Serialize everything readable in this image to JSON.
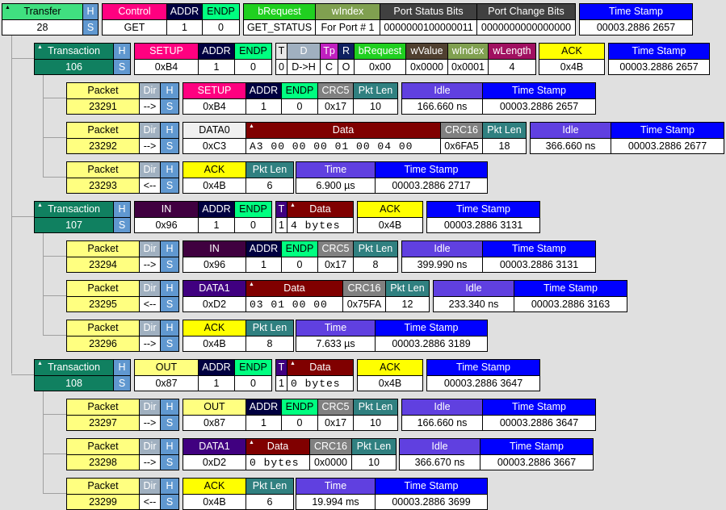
{
  "colors": {
    "transfer": "#40e080",
    "transaction": "#108060",
    "hs": "#6098d0",
    "packet": "#ffff80",
    "dir": "#a0b0c0",
    "addr": "#000040",
    "endp": "#00ff80",
    "setup": "#ff0080",
    "control": "#ff0080",
    "in": "#400040",
    "out": "#ffff80",
    "data0": "#f0f0f0",
    "data1": "#400080",
    "data": "#800000",
    "crc": "#808080",
    "pktlen": "#308080",
    "idle": "#6040e0",
    "timestamp": "#0000ff",
    "ack": "#ffff00",
    "brequest": "#20d020",
    "windex": "#80a050",
    "bits": "#404040",
    "wvalue": "#504030",
    "wlength": "#a01060",
    "tp": "#c020c0",
    "r": "#102060",
    "t": "#e8e8e8",
    "t2": "#400080",
    "d": "#a0b0c0"
  },
  "rows": [
    {
      "groups": [
        [
          {
            "h": "Transfer",
            "v": "28",
            "c": "transfer",
            "dark": 1,
            "mark": 1
          },
          {
            "h": "H",
            "v": "S",
            "c": "hs",
            "vc": "hs"
          }
        ],
        [
          {
            "h": "Control",
            "v": "GET",
            "c": "control"
          },
          {
            "h": "ADDR",
            "v": "1",
            "c": "addr"
          },
          {
            "h": "ENDP",
            "v": "0",
            "c": "endp",
            "dark": 1
          }
        ],
        [
          {
            "h": "bRequest",
            "v": "GET_STATUS",
            "c": "brequest"
          },
          {
            "h": "wIndex",
            "v": "For Port # 1",
            "c": "windex"
          },
          {
            "h": "Port Status Bits",
            "v": "0000000100000011",
            "c": "bits"
          },
          {
            "h": "Port Change Bits",
            "v": "0000000000000000",
            "c": "bits"
          }
        ],
        [
          {
            "h": "Time Stamp",
            "v": "00003.2886 2657",
            "c": "timestamp"
          }
        ]
      ]
    },
    {
      "groups": [
        [
          {
            "h": "Transaction",
            "v": "106",
            "c": "transaction",
            "vc": "transaction",
            "mark": 1
          },
          {
            "h": "H",
            "v": "S",
            "c": "hs",
            "vc": "hs"
          }
        ],
        [
          {
            "h": "SETUP",
            "v": "0xB4",
            "c": "setup"
          },
          {
            "h": "ADDR",
            "v": "1",
            "c": "addr"
          },
          {
            "h": "ENDP",
            "v": "0",
            "c": "endp",
            "dark": 1
          }
        ],
        [
          {
            "h": "T",
            "v": "0",
            "c": "t",
            "dark": 1
          },
          {
            "h": "D",
            "v": "D->H",
            "c": "d"
          },
          {
            "h": "Tp",
            "v": "C",
            "c": "tp"
          },
          {
            "h": "R",
            "v": "O",
            "c": "r"
          },
          {
            "h": "bRequest",
            "v": "0x00",
            "c": "brequest"
          },
          {
            "h": "wValue",
            "v": "0x0000",
            "c": "wvalue"
          },
          {
            "h": "wIndex",
            "v": "0x0001",
            "c": "windex"
          },
          {
            "h": "wLength",
            "v": "4",
            "c": "wlength"
          }
        ],
        [
          {
            "h": "ACK",
            "v": "0x4B",
            "c": "ack",
            "dark": 1
          }
        ],
        [
          {
            "h": "Time Stamp",
            "v": "00003.2886 2657",
            "c": "timestamp"
          }
        ]
      ]
    },
    {
      "groups": [
        [
          {
            "h": "Packet",
            "v": "23291",
            "c": "packet",
            "vc": "packet",
            "dark": 1
          },
          {
            "h": "Dir",
            "v": "-->",
            "c": "dir"
          },
          {
            "h": "H",
            "v": "S",
            "c": "hs",
            "vc": "hs"
          }
        ],
        [
          {
            "h": "SETUP",
            "v": "0xB4",
            "c": "setup"
          },
          {
            "h": "ADDR",
            "v": "1",
            "c": "addr"
          },
          {
            "h": "ENDP",
            "v": "0",
            "c": "endp",
            "dark": 1
          },
          {
            "h": "CRC5",
            "v": "0x17",
            "c": "crc"
          },
          {
            "h": "Pkt Len",
            "v": "10",
            "c": "pktlen"
          }
        ],
        [
          {
            "h": "Idle",
            "v": "166.660 ns",
            "c": "idle"
          },
          {
            "h": "Time Stamp",
            "v": "00003.2886 2657",
            "c": "timestamp"
          }
        ]
      ]
    },
    {
      "groups": [
        [
          {
            "h": "Packet",
            "v": "23292",
            "c": "packet",
            "vc": "packet",
            "dark": 1
          },
          {
            "h": "Dir",
            "v": "-->",
            "c": "dir"
          },
          {
            "h": "H",
            "v": "S",
            "c": "hs",
            "vc": "hs"
          }
        ],
        [
          {
            "h": "DATA0",
            "v": "0xC3",
            "c": "data0",
            "dark": 1
          },
          {
            "h": "Data",
            "v": "A3 00 00 00 01 00 04 00",
            "c": "data",
            "mono": 1,
            "mark": 1
          },
          {
            "h": "CRC16",
            "v": "0x6FA5",
            "c": "crc"
          },
          {
            "h": "Pkt Len",
            "v": "18",
            "c": "pktlen"
          }
        ],
        [
          {
            "h": "Idle",
            "v": "366.660 ns",
            "c": "idle"
          },
          {
            "h": "Time Stamp",
            "v": "00003.2886 2677",
            "c": "timestamp"
          }
        ]
      ]
    },
    {
      "groups": [
        [
          {
            "h": "Packet",
            "v": "23293",
            "c": "packet",
            "vc": "packet",
            "dark": 1
          },
          {
            "h": "Dir",
            "v": "<--",
            "c": "dir"
          },
          {
            "h": "H",
            "v": "S",
            "c": "hs",
            "vc": "hs"
          }
        ],
        [
          {
            "h": "ACK",
            "v": "0x4B",
            "c": "ack",
            "dark": 1
          },
          {
            "h": "Pkt Len",
            "v": "6",
            "c": "pktlen"
          }
        ],
        [
          {
            "h": "Time",
            "v": "6.900 µs",
            "c": "idle"
          },
          {
            "h": "Time Stamp",
            "v": "00003.2886 2717",
            "c": "timestamp"
          }
        ]
      ]
    },
    {
      "groups": [
        [
          {
            "h": "Transaction",
            "v": "107",
            "c": "transaction",
            "vc": "transaction",
            "mark": 1
          },
          {
            "h": "H",
            "v": "S",
            "c": "hs",
            "vc": "hs"
          }
        ],
        [
          {
            "h": "IN",
            "v": "0x96",
            "c": "in"
          },
          {
            "h": "ADDR",
            "v": "1",
            "c": "addr"
          },
          {
            "h": "ENDP",
            "v": "0",
            "c": "endp",
            "dark": 1
          }
        ],
        [
          {
            "h": "T",
            "v": "1",
            "c": "t2"
          },
          {
            "h": "Data",
            "v": "4 bytes",
            "c": "data",
            "mono": 1,
            "mark": 1
          }
        ],
        [
          {
            "h": "ACK",
            "v": "0x4B",
            "c": "ack",
            "dark": 1
          }
        ],
        [
          {
            "h": "Time Stamp",
            "v": "00003.2886 3131",
            "c": "timestamp"
          }
        ]
      ]
    },
    {
      "groups": [
        [
          {
            "h": "Packet",
            "v": "23294",
            "c": "packet",
            "vc": "packet",
            "dark": 1
          },
          {
            "h": "Dir",
            "v": "-->",
            "c": "dir"
          },
          {
            "h": "H",
            "v": "S",
            "c": "hs",
            "vc": "hs"
          }
        ],
        [
          {
            "h": "IN",
            "v": "0x96",
            "c": "in"
          },
          {
            "h": "ADDR",
            "v": "1",
            "c": "addr"
          },
          {
            "h": "ENDP",
            "v": "0",
            "c": "endp",
            "dark": 1
          },
          {
            "h": "CRC5",
            "v": "0x17",
            "c": "crc"
          },
          {
            "h": "Pkt Len",
            "v": "8",
            "c": "pktlen"
          }
        ],
        [
          {
            "h": "Idle",
            "v": "399.990 ns",
            "c": "idle"
          },
          {
            "h": "Time Stamp",
            "v": "00003.2886 3131",
            "c": "timestamp"
          }
        ]
      ]
    },
    {
      "groups": [
        [
          {
            "h": "Packet",
            "v": "23295",
            "c": "packet",
            "vc": "packet",
            "dark": 1
          },
          {
            "h": "Dir",
            "v": "<--",
            "c": "dir"
          },
          {
            "h": "H",
            "v": "S",
            "c": "hs",
            "vc": "hs"
          }
        ],
        [
          {
            "h": "DATA1",
            "v": "0xD2",
            "c": "data1"
          },
          {
            "h": "Data",
            "v": "03 01 00 00",
            "c": "data",
            "mono": 1,
            "mark": 1
          },
          {
            "h": "CRC16",
            "v": "0x75FA",
            "c": "crc"
          },
          {
            "h": "Pkt Len",
            "v": "12",
            "c": "pktlen"
          }
        ],
        [
          {
            "h": "Idle",
            "v": "233.340 ns",
            "c": "idle"
          },
          {
            "h": "Time Stamp",
            "v": "00003.2886 3163",
            "c": "timestamp"
          }
        ]
      ]
    },
    {
      "groups": [
        [
          {
            "h": "Packet",
            "v": "23296",
            "c": "packet",
            "vc": "packet",
            "dark": 1
          },
          {
            "h": "Dir",
            "v": "-->",
            "c": "dir"
          },
          {
            "h": "H",
            "v": "S",
            "c": "hs",
            "vc": "hs"
          }
        ],
        [
          {
            "h": "ACK",
            "v": "0x4B",
            "c": "ack",
            "dark": 1
          },
          {
            "h": "Pkt Len",
            "v": "8",
            "c": "pktlen"
          }
        ],
        [
          {
            "h": "Time",
            "v": "7.633 µs",
            "c": "idle"
          },
          {
            "h": "Time Stamp",
            "v": "00003.2886 3189",
            "c": "timestamp"
          }
        ]
      ]
    },
    {
      "groups": [
        [
          {
            "h": "Transaction",
            "v": "108",
            "c": "transaction",
            "vc": "transaction",
            "mark": 1
          },
          {
            "h": "H",
            "v": "S",
            "c": "hs",
            "vc": "hs"
          }
        ],
        [
          {
            "h": "OUT",
            "v": "0x87",
            "c": "out",
            "dark": 1
          },
          {
            "h": "ADDR",
            "v": "1",
            "c": "addr"
          },
          {
            "h": "ENDP",
            "v": "0",
            "c": "endp",
            "dark": 1
          }
        ],
        [
          {
            "h": "T",
            "v": "1",
            "c": "t2"
          },
          {
            "h": "Data",
            "v": "0 bytes",
            "c": "data",
            "mono": 1,
            "mark": 1
          }
        ],
        [
          {
            "h": "ACK",
            "v": "0x4B",
            "c": "ack",
            "dark": 1
          }
        ],
        [
          {
            "h": "Time Stamp",
            "v": "00003.2886 3647",
            "c": "timestamp"
          }
        ]
      ]
    },
    {
      "groups": [
        [
          {
            "h": "Packet",
            "v": "23297",
            "c": "packet",
            "vc": "packet",
            "dark": 1
          },
          {
            "h": "Dir",
            "v": "-->",
            "c": "dir"
          },
          {
            "h": "H",
            "v": "S",
            "c": "hs",
            "vc": "hs"
          }
        ],
        [
          {
            "h": "OUT",
            "v": "0x87",
            "c": "out",
            "dark": 1
          },
          {
            "h": "ADDR",
            "v": "1",
            "c": "addr"
          },
          {
            "h": "ENDP",
            "v": "0",
            "c": "endp",
            "dark": 1
          },
          {
            "h": "CRC5",
            "v": "0x17",
            "c": "crc"
          },
          {
            "h": "Pkt Len",
            "v": "10",
            "c": "pktlen"
          }
        ],
        [
          {
            "h": "Idle",
            "v": "166.660 ns",
            "c": "idle"
          },
          {
            "h": "Time Stamp",
            "v": "00003.2886 3647",
            "c": "timestamp"
          }
        ]
      ]
    },
    {
      "groups": [
        [
          {
            "h": "Packet",
            "v": "23298",
            "c": "packet",
            "vc": "packet",
            "dark": 1
          },
          {
            "h": "Dir",
            "v": "-->",
            "c": "dir"
          },
          {
            "h": "H",
            "v": "S",
            "c": "hs",
            "vc": "hs"
          }
        ],
        [
          {
            "h": "DATA1",
            "v": "0xD2",
            "c": "data1"
          },
          {
            "h": "Data",
            "v": "0 bytes",
            "c": "data",
            "mono": 1,
            "mark": 1
          },
          {
            "h": "CRC16",
            "v": "0x0000",
            "c": "crc"
          },
          {
            "h": "Pkt Len",
            "v": "10",
            "c": "pktlen"
          }
        ],
        [
          {
            "h": "Idle",
            "v": "366.670 ns",
            "c": "idle"
          },
          {
            "h": "Time Stamp",
            "v": "00003.2886 3667",
            "c": "timestamp"
          }
        ]
      ]
    },
    {
      "groups": [
        [
          {
            "h": "Packet",
            "v": "23299",
            "c": "packet",
            "vc": "packet",
            "dark": 1
          },
          {
            "h": "Dir",
            "v": "<--",
            "c": "dir"
          },
          {
            "h": "H",
            "v": "S",
            "c": "hs",
            "vc": "hs"
          }
        ],
        [
          {
            "h": "ACK",
            "v": "0x4B",
            "c": "ack",
            "dark": 1
          },
          {
            "h": "Pkt Len",
            "v": "6",
            "c": "pktlen"
          }
        ],
        [
          {
            "h": "Time",
            "v": "19.994 ms",
            "c": "idle"
          },
          {
            "h": "Time Stamp",
            "v": "00003.2886 3699",
            "c": "timestamp"
          }
        ]
      ]
    }
  ]
}
